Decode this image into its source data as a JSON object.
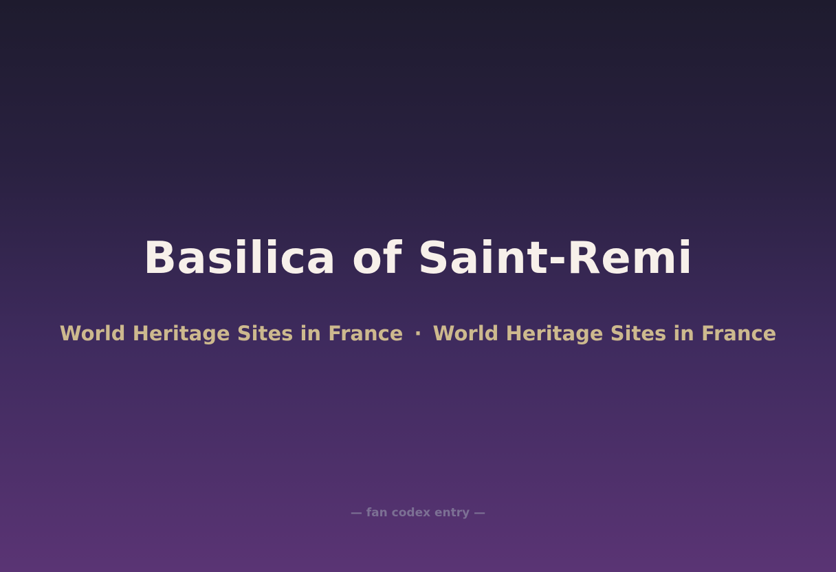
{
  "title": "Basilica of Saint-Remi",
  "subtitle": {
    "left": "World Heritage Sites in France",
    "separator": "·",
    "right": "World Heritage Sites in France"
  },
  "footer": "— fan codex entry —",
  "colors": {
    "title": "#f7f0ea",
    "subtitle": "#cdb98e",
    "footer": "#7c7094",
    "background_top": "#1e1b2e",
    "background_bottom": "#5a3474"
  }
}
